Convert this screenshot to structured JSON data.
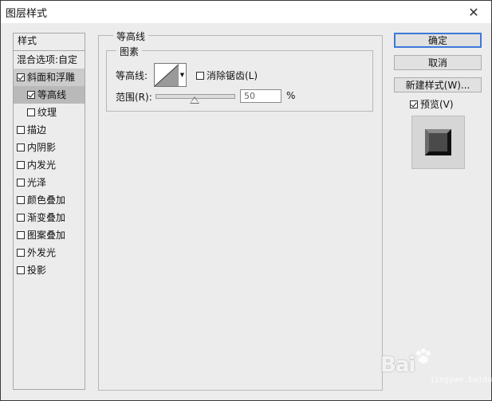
{
  "window": {
    "title": "图层样式",
    "close_glyph": "✕"
  },
  "stylelist": {
    "header": "样式",
    "items": [
      {
        "label": "混合选项:自定",
        "checkbox": false,
        "checked": false,
        "state": "normal"
      },
      {
        "label": "斜面和浮雕",
        "checkbox": true,
        "checked": true,
        "state": "active"
      },
      {
        "label": "等高线",
        "checkbox": true,
        "checked": true,
        "state": "sub-selected"
      },
      {
        "label": "纹理",
        "checkbox": true,
        "checked": false,
        "state": "sub"
      },
      {
        "label": "描边",
        "checkbox": true,
        "checked": false,
        "state": "normal"
      },
      {
        "label": "内阴影",
        "checkbox": true,
        "checked": false,
        "state": "normal"
      },
      {
        "label": "内发光",
        "checkbox": true,
        "checked": false,
        "state": "normal"
      },
      {
        "label": "光泽",
        "checkbox": true,
        "checked": false,
        "state": "normal"
      },
      {
        "label": "颜色叠加",
        "checkbox": true,
        "checked": false,
        "state": "normal"
      },
      {
        "label": "渐变叠加",
        "checkbox": true,
        "checked": false,
        "state": "normal"
      },
      {
        "label": "图案叠加",
        "checkbox": true,
        "checked": false,
        "state": "normal"
      },
      {
        "label": "外发光",
        "checkbox": true,
        "checked": false,
        "state": "normal"
      },
      {
        "label": "投影",
        "checkbox": true,
        "checked": false,
        "state": "normal"
      }
    ]
  },
  "panel": {
    "group_title": "等高线",
    "subgroup_title": "图素",
    "contour_label": "等高线:",
    "antialias_label": "消除锯齿(L)",
    "antialias_checked": false,
    "range_label": "范围(R):",
    "range_value": "50",
    "range_percent": 50,
    "percent_sign": "%"
  },
  "buttons": {
    "ok": "确定",
    "cancel": "取消",
    "new_style": "新建样式(W)...",
    "preview_label": "预览(V)",
    "preview_checked": true
  },
  "watermark": {
    "logo": "Bai",
    "sub": "jingyan.baidu.com"
  },
  "colors": {
    "dialog_bg": "#ececec",
    "primary_border": "#3c78d8",
    "selected_bg": "#b9b9b9"
  },
  "icons": {
    "close": "close-icon",
    "dropdown": "dropdown-arrow-icon",
    "contour": "contour-curve-icon"
  }
}
